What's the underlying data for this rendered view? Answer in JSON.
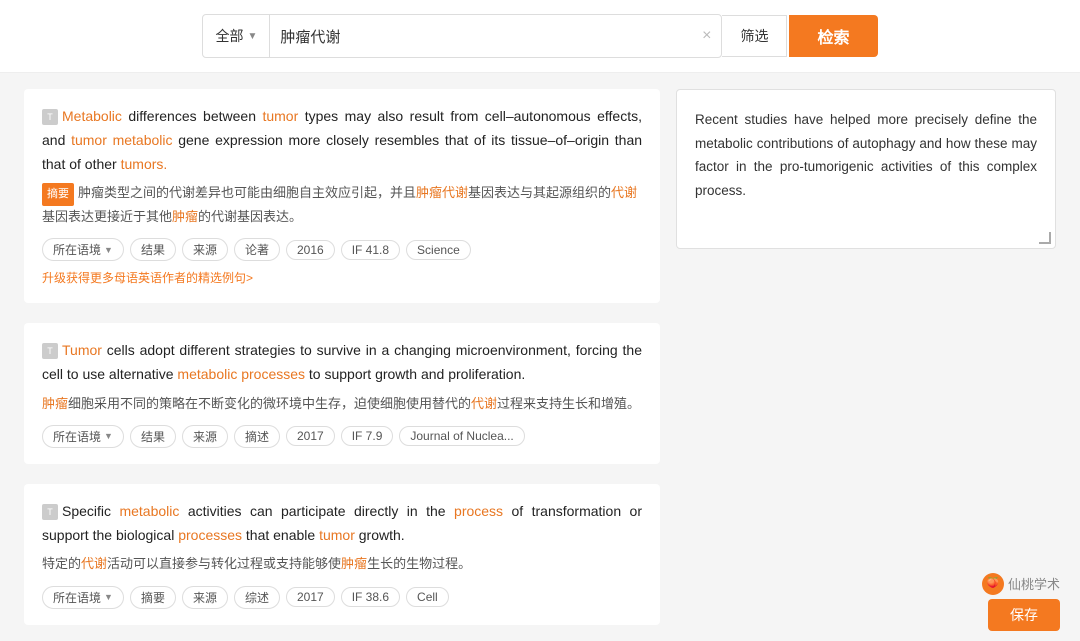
{
  "search": {
    "category_label": "全部",
    "query": "肿瘤代谢",
    "filter_label": "筛选",
    "search_label": "检索",
    "clear_icon": "×"
  },
  "right_panel": {
    "content": "Recent studies have helped more precisely define the metabolic contributions of autophagy and how these may factor in the pro-tumorigenic activities of this complex process."
  },
  "results": [
    {
      "id": 1,
      "en_parts": [
        {
          "text": "Metabolic",
          "type": "orange"
        },
        {
          "text": " differences between ",
          "type": "normal"
        },
        {
          "text": "tumor",
          "type": "orange"
        },
        {
          "text": " types may also result from cell–autonomous effects, and ",
          "type": "normal"
        },
        {
          "text": "tumor",
          "type": "orange"
        },
        {
          "text": " ",
          "type": "normal"
        },
        {
          "text": "metabolic",
          "type": "orange"
        },
        {
          "text": " gene expression more closely resembles that of its tissue–of–origin than that of other ",
          "type": "normal"
        },
        {
          "text": "tumors.",
          "type": "orange"
        }
      ],
      "cn_tag": "摘要",
      "cn_text": "肿瘤类型之间的代谢差异也可能由细胞自主效应引起，并且",
      "cn_highlight": "肿瘤代谢",
      "cn_text2": "基因表达与其起源组织的",
      "cn_highlight2": "代谢",
      "cn_text3": "基因表达更接近于其他",
      "cn_highlight3": "肿瘤",
      "cn_text4": "的代谢基因表达。",
      "meta": {
        "location": "所在语境",
        "tags": [
          "结果",
          "来源",
          "论著"
        ],
        "year": "2016",
        "if": "IF 41.8",
        "journal": "Science"
      },
      "upgrade_text": "升级获得更多母语英语作者的精选例句>"
    },
    {
      "id": 2,
      "en_parts": [
        {
          "text": "Tumor",
          "type": "orange"
        },
        {
          "text": " cells adopt different strategies to survive in a changing microenvironment, forcing the cell to use alternative ",
          "type": "normal"
        },
        {
          "text": "metabolic processes",
          "type": "orange"
        },
        {
          "text": " to support growth and proliferation.",
          "type": "normal"
        }
      ],
      "cn_tag": null,
      "cn_text": "肿瘤",
      "cn_highlight": "肿瘤",
      "cn_text_full": "细胞采用不同的策略在不断变化的微环境中生存，迫使细胞使用替代的",
      "cn_highlight2": "代谢",
      "cn_text2": "过程来支持生长和增殖。",
      "meta": {
        "location": "所在语境",
        "tags": [
          "结果",
          "来源",
          "摘述"
        ],
        "year": "2017",
        "if": "IF 7.9",
        "journal": "Journal of Nuclea..."
      }
    },
    {
      "id": 3,
      "en_parts": [
        {
          "text": "Specific ",
          "type": "normal"
        },
        {
          "text": "metabolic",
          "type": "orange"
        },
        {
          "text": " activities can participate directly in the ",
          "type": "normal"
        },
        {
          "text": "process",
          "type": "orange"
        },
        {
          "text": " of transformation or support the biological ",
          "type": "normal"
        },
        {
          "text": "processes",
          "type": "orange"
        },
        {
          "text": " that enable ",
          "type": "normal"
        },
        {
          "text": "tumor",
          "type": "orange"
        },
        {
          "text": " growth.",
          "type": "normal"
        }
      ],
      "cn_tag": null,
      "cn_text_full": "特定的",
      "cn_highlight": "代谢",
      "cn_text2": "活动可以直接参与转化过程或支持能够使",
      "cn_highlight2": "肿瘤",
      "cn_text3": "生长的生物过程。",
      "meta": {
        "location": "所在语境",
        "tags": [
          "摘要",
          "来源",
          "综述"
        ],
        "year": "2017",
        "if": "IF 38.6",
        "journal": "Cell"
      }
    }
  ],
  "bottom": {
    "logo_label": "仙桃学术",
    "save_label": "保存"
  }
}
